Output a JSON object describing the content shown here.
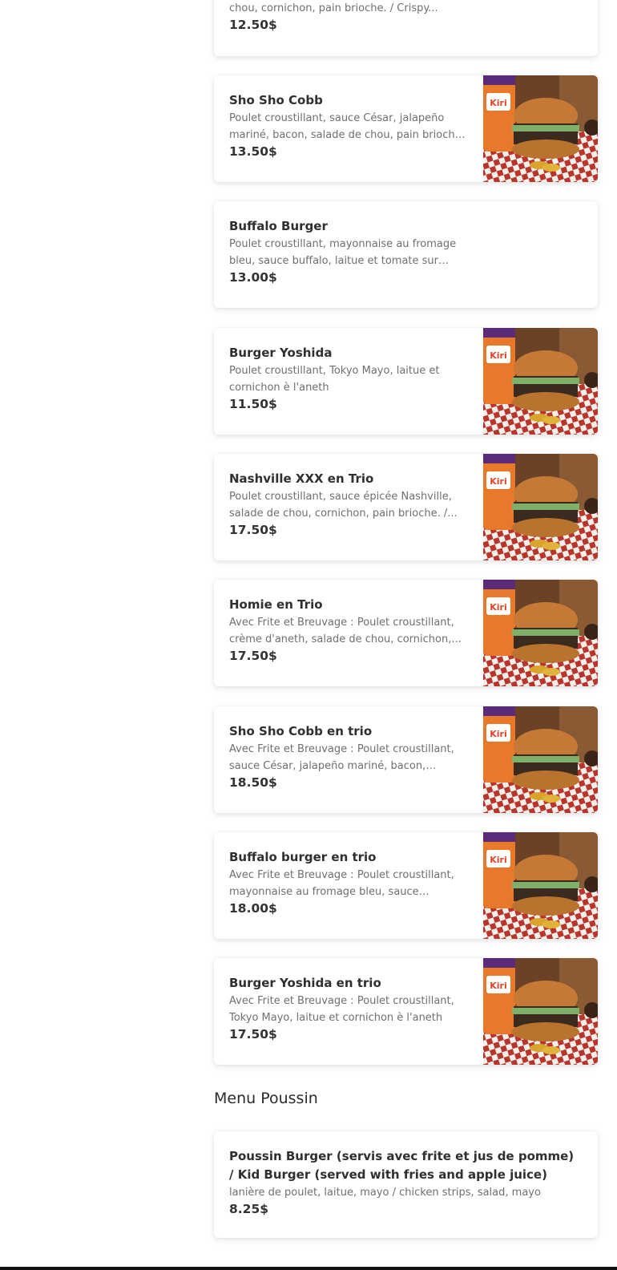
{
  "top_item": {
    "desc_tail": "chou, cornichon, pain brioche. / Crispy...",
    "price": "12.50$"
  },
  "items": [
    {
      "name": "Sho Sho Cobb",
      "desc": "Poulet croustillant, sauce César, jalapeño mariné, bacon, salade de chou, pain brioche. ...",
      "price": "13.50$",
      "has_image": true
    },
    {
      "name": "Buffalo Burger",
      "desc": "Poulet croustillant, mayonnaise au fromage bleu, sauce buffalo, laitue et tomate sur pain...",
      "price": "13.00$",
      "has_image": false
    },
    {
      "name": "Burger Yoshida",
      "desc": "Poulet croustillant, Tokyo Mayo, laitue et cornichon è l'aneth",
      "price": "11.50$",
      "has_image": true
    },
    {
      "name": "Nashville XXX en Trio",
      "desc": "Poulet croustillant, sauce épicée Nashville, salade de chou, cornichon, pain brioche. /...",
      "price": "17.50$",
      "has_image": true
    },
    {
      "name": "Homie en Trio",
      "desc": "Avec Frite et Breuvage : Poulet croustillant, crème d'aneth, salade de chou, cornichon,...",
      "price": "17.50$",
      "has_image": true
    },
    {
      "name": "Sho Sho Cobb en trio",
      "desc": "Avec Frite et Breuvage : Poulet croustillant, sauce César, jalapeño mariné, bacon, salade...",
      "price": "18.50$",
      "has_image": true
    },
    {
      "name": "Buffalo burger en trio",
      "desc": "Avec Frite et Breuvage : Poulet croustillant, mayonnaise au fromage bleu, sauce buffalo,...",
      "price": "18.00$",
      "has_image": true
    },
    {
      "name": "Burger Yoshida en trio",
      "desc": "Avec Frite et Breuvage : Poulet croustillant, Tokyo Mayo, laitue et cornichon è l'aneth",
      "price": "17.50$",
      "has_image": true
    }
  ],
  "section": {
    "title": "Menu Poussin"
  },
  "kid_item": {
    "name": "Poussin Burger (servis avec frite et jus de pomme) / Kid Burger (served with fries and apple juice)",
    "desc": "lanière de poulet, laitue, mayo / chicken strips, salad, mayo",
    "price": "8.25$"
  },
  "image_icon": "burger-photo",
  "colors": {
    "card_bg": "#ffffff",
    "text": "#2f2f2f",
    "muted": "#6f6f6f",
    "checker_red": "#b8352e"
  }
}
